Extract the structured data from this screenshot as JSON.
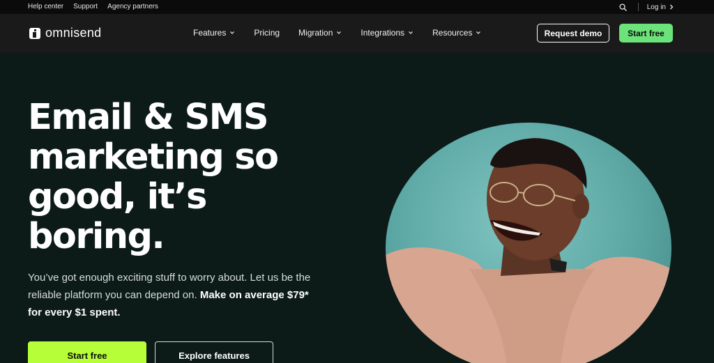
{
  "topbar": {
    "links": [
      "Help center",
      "Support",
      "Agency partners"
    ],
    "login_label": "Log in"
  },
  "nav": {
    "logo_text": "omnisend",
    "menu": [
      {
        "label": "Features",
        "has_dropdown": true
      },
      {
        "label": "Pricing",
        "has_dropdown": false
      },
      {
        "label": "Migration",
        "has_dropdown": true
      },
      {
        "label": "Integrations",
        "has_dropdown": true
      },
      {
        "label": "Resources",
        "has_dropdown": true
      }
    ],
    "request_demo_label": "Request demo",
    "start_free_label": "Start free"
  },
  "hero": {
    "headline_lines": [
      "Email & SMS",
      "marketing so",
      "good, it’s",
      "boring."
    ],
    "subcopy_plain": "You’ve got enough exciting stuff to worry about. Let us be the reliable platform you can depend on.",
    "subcopy_bold": "Make on average $79* for every $1 spent.",
    "cta_primary": "Start free",
    "cta_secondary": "Explore features"
  },
  "colors": {
    "nav_background": "#1a1a1a",
    "hero_background": "#0c1a18",
    "accent_green": "#6be37a",
    "cta_lime": "#b6ff38",
    "image_teal": "#5ca7a4",
    "sweater_pink": "#d8a690"
  }
}
